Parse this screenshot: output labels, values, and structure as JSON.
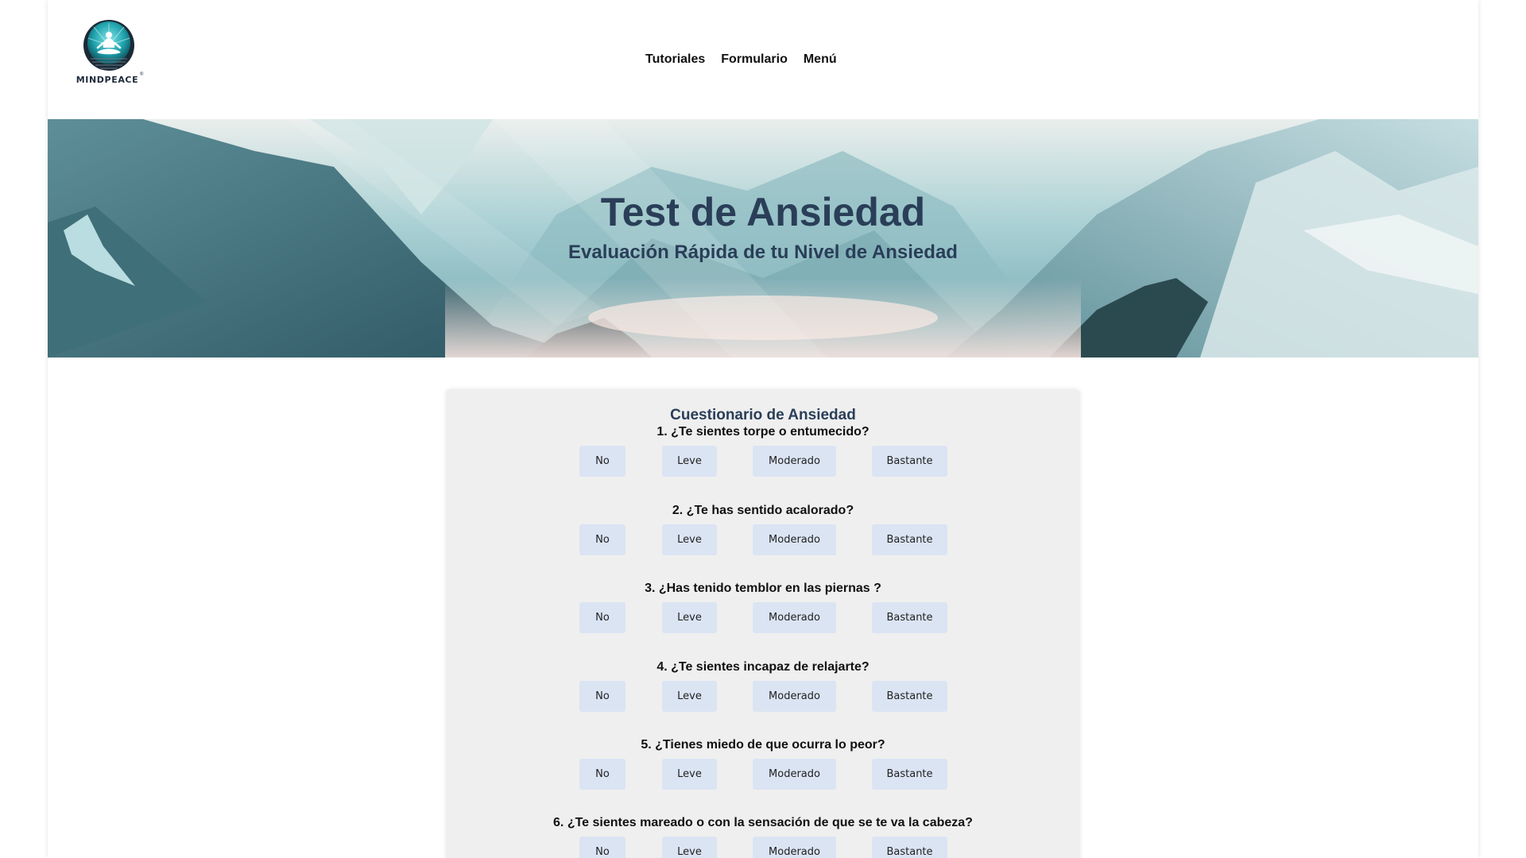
{
  "brand": {
    "name": "MINDPEACE",
    "reg": "®"
  },
  "nav": {
    "items": [
      "Tutoriales",
      "Formulario",
      "Menú"
    ]
  },
  "hero": {
    "title": "Test de Ansiedad",
    "subtitle": "Evaluación Rápida de tu Nivel de Ansiedad"
  },
  "quiz": {
    "title": "Cuestionario de Ansiedad",
    "options": [
      "No",
      "Leve",
      "Moderado",
      "Bastante"
    ],
    "questions": [
      "1. ¿Te sientes torpe o entumecido?",
      "2. ¿Te has sentido acalorado?",
      "3. ¿Has tenido temblor en las piernas ?",
      "4. ¿Te sientes incapaz de relajarte?",
      "5. ¿Tienes miedo de que ocurra lo peor?",
      "6. ¿Te sientes mareado o con la sensación de que se te va la cabeza?"
    ]
  },
  "colors": {
    "accent": "#2a3e58",
    "option_bg": "#dbe4f3",
    "card_bg": "#efefef"
  },
  "icons": {
    "logo": "meditating-figure-icon"
  }
}
